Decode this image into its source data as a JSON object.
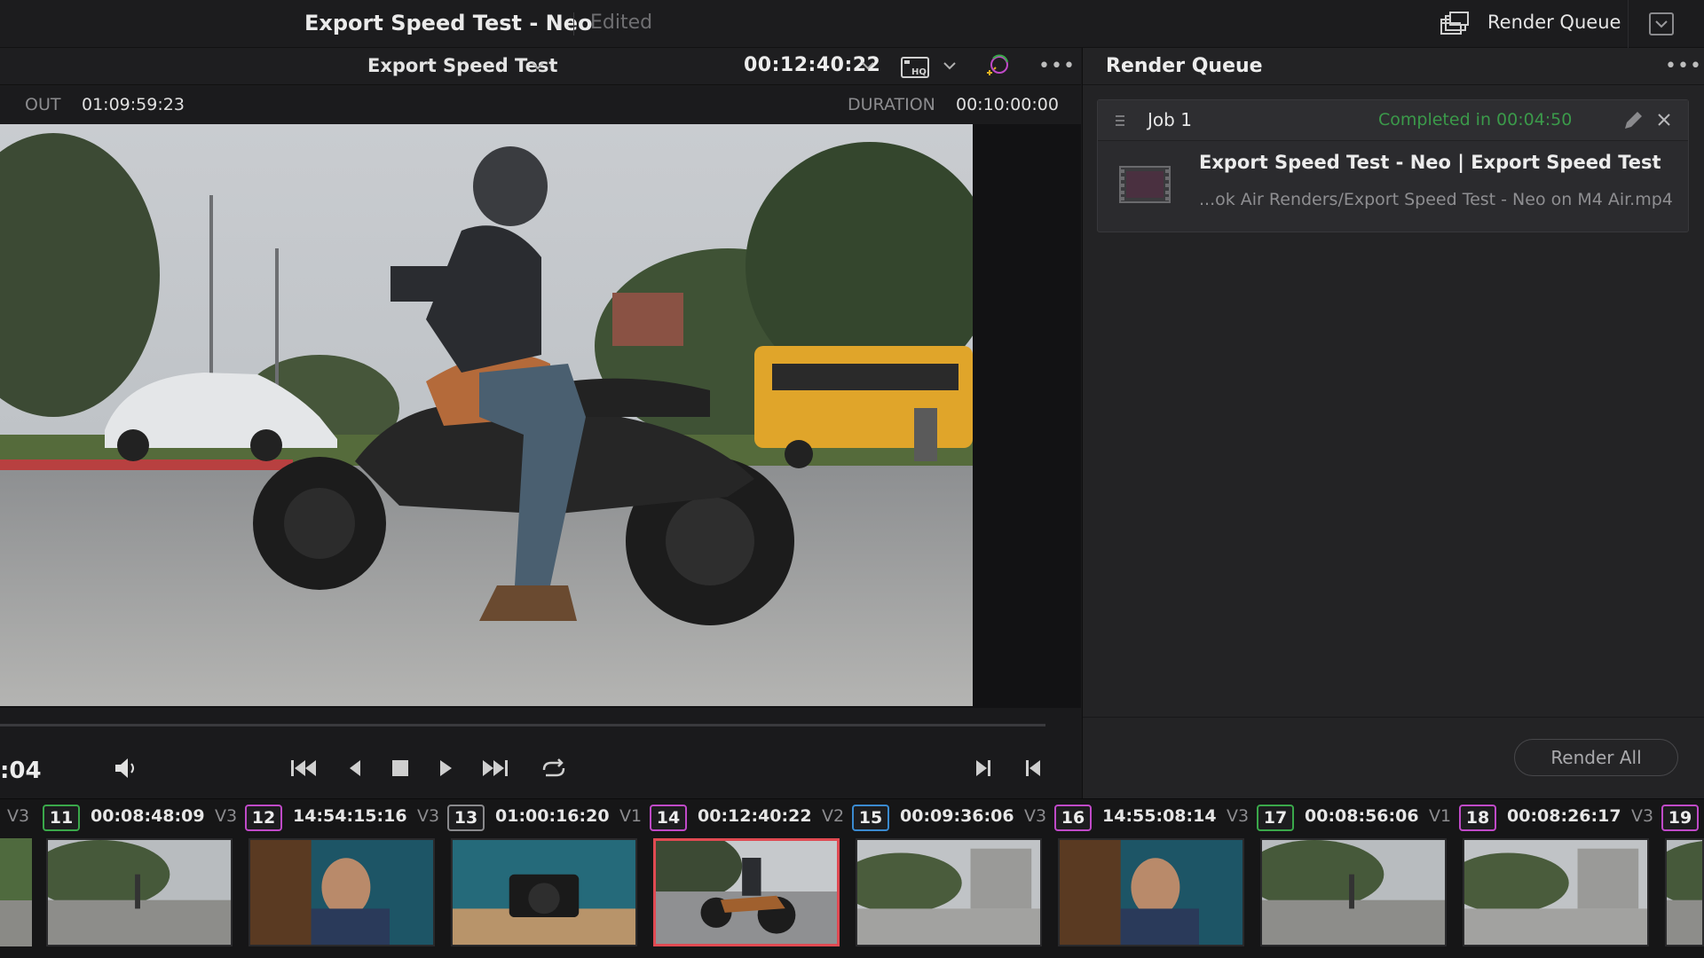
{
  "window": {
    "project_title": "Export Speed Test - Neo",
    "edited_label": "Edited",
    "render_queue_button": "Render Queue"
  },
  "viewer": {
    "timeline_name": "Export Speed Test",
    "timecode": "00:12:40:22",
    "out_label": "OUT",
    "out_value": "01:09:59:23",
    "duration_label": "DURATION",
    "duration_value": "00:10:00:00",
    "current_tc_partial": ":04"
  },
  "render_queue": {
    "title": "Render Queue",
    "jobs": [
      {
        "name": "Job 1",
        "status": "Completed in 00:04:50",
        "title": "Export Speed Test - Neo | Export Speed Test",
        "path": "...ok Air Renders/Export Speed Test - Neo on M4 Air.mp4"
      }
    ],
    "render_all_label": "Render All"
  },
  "clips": [
    {
      "track": "V3",
      "num": "11",
      "tc": "00:08:48:09",
      "color": "#3aa84a",
      "scene": "skate"
    },
    {
      "track": "V3",
      "num": "12",
      "tc": "14:54:15:16",
      "color": "#c04ac8",
      "scene": "person"
    },
    {
      "track": "V1",
      "num": "13",
      "tc": "01:00:16:20",
      "color": "#8a8a8d",
      "scene": "camera"
    },
    {
      "track": "V2",
      "num": "14",
      "tc": "00:12:40:22",
      "color": "#c04ac8",
      "scene": "moto"
    },
    {
      "track": "V3",
      "num": "15",
      "tc": "00:09:36:06",
      "color": "#3a8ad0",
      "scene": "skate2"
    },
    {
      "track": "V3",
      "num": "16",
      "tc": "14:55:08:14",
      "color": "#c04ac8",
      "scene": "person"
    },
    {
      "track": "V1",
      "num": "17",
      "tc": "00:08:56:06",
      "color": "#3aa84a",
      "scene": "skate"
    },
    {
      "track": "V3",
      "num": "18",
      "tc": "00:08:26:17",
      "color": "#c04ac8",
      "scene": "skate2"
    },
    {
      "track": "V3",
      "num": "19",
      "tc": "",
      "color": "#c04ac8",
      "scene": "skate"
    }
  ],
  "icons": {
    "render_queue": "render-queue-icon",
    "collapse": "collapse-icon",
    "volume": "volume-icon",
    "skip_start": "skip-start-icon",
    "step_back": "step-back-icon",
    "stop": "stop-icon",
    "play": "play-icon",
    "skip_end": "skip-end-icon",
    "loop": "loop-icon",
    "mark_in": "mark-in-icon",
    "mark_out": "mark-out-icon"
  }
}
